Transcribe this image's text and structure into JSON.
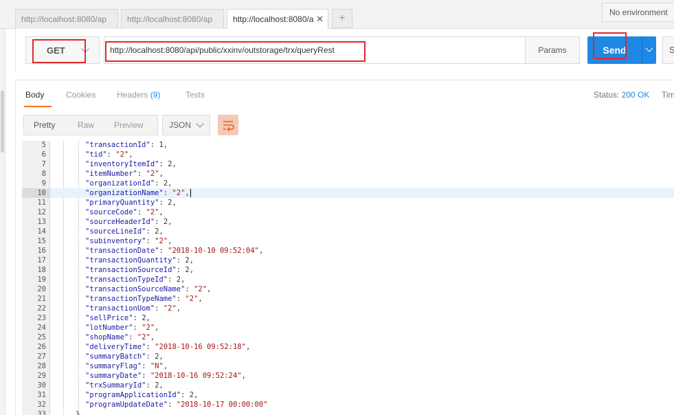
{
  "tabs": [
    {
      "label": "http://localhost:8080/ap",
      "active": false
    },
    {
      "label": "http://localhost:8080/ap",
      "active": false
    },
    {
      "label": "http://localhost:8080/a",
      "active": true
    }
  ],
  "tab_close_glyph": "✕",
  "tab_add_glyph": "+",
  "environment": "No environment",
  "request": {
    "method": "GET",
    "url": "http://localhost:8080/api/public/xxinv/outstorage/trx/queryRest",
    "params_label": "Params",
    "send_label": "Send",
    "save_label": "S"
  },
  "response": {
    "tabs": {
      "body": "Body",
      "cookies": "Cookies",
      "headers": "Headers",
      "headers_count": "(9)",
      "tests": "Tests"
    },
    "status_label": "Status:",
    "status_value": "200 OK",
    "time_label": "Tim",
    "view_modes": [
      "Pretty",
      "Raw",
      "Preview"
    ],
    "format": "JSON",
    "wrap_icon": "wrap-lines-icon"
  },
  "code_lines": [
    {
      "n": "5",
      "key": "\"transactionId\"",
      "val": "1",
      "t": "n"
    },
    {
      "n": "6",
      "key": "\"tid\"",
      "val": "\"2\"",
      "t": "s"
    },
    {
      "n": "7",
      "key": "\"inventoryItemId\"",
      "val": "2",
      "t": "n"
    },
    {
      "n": "8",
      "key": "\"itemNumber\"",
      "val": "\"2\"",
      "t": "s"
    },
    {
      "n": "9",
      "key": "\"organizationId\"",
      "val": "2",
      "t": "n"
    },
    {
      "n": "10",
      "key": "\"organizationName\"",
      "val": "\"2\"",
      "t": "s"
    },
    {
      "n": "11",
      "key": "\"primaryQuantity\"",
      "val": "2",
      "t": "n"
    },
    {
      "n": "12",
      "key": "\"sourceCode\"",
      "val": "\"2\"",
      "t": "s"
    },
    {
      "n": "13",
      "key": "\"sourceHeaderId\"",
      "val": "2",
      "t": "n"
    },
    {
      "n": "14",
      "key": "\"sourceLineId\"",
      "val": "2",
      "t": "n"
    },
    {
      "n": "15",
      "key": "\"subinventory\"",
      "val": "\"2\"",
      "t": "s"
    },
    {
      "n": "16",
      "key": "\"transactionDate\"",
      "val": "\"2018-10-10 09:52:04\"",
      "t": "s"
    },
    {
      "n": "17",
      "key": "\"transactionQuantity\"",
      "val": "2",
      "t": "n"
    },
    {
      "n": "18",
      "key": "\"transactionSourceId\"",
      "val": "2",
      "t": "n"
    },
    {
      "n": "19",
      "key": "\"transactionTypeId\"",
      "val": "2",
      "t": "n"
    },
    {
      "n": "20",
      "key": "\"transactionSourceName\"",
      "val": "\"2\"",
      "t": "s"
    },
    {
      "n": "21",
      "key": "\"transactionTypeName\"",
      "val": "\"2\"",
      "t": "s"
    },
    {
      "n": "22",
      "key": "\"transactionUom\"",
      "val": "\"2\"",
      "t": "s"
    },
    {
      "n": "23",
      "key": "\"sellPrice\"",
      "val": "2",
      "t": "n"
    },
    {
      "n": "24",
      "key": "\"lotNumber\"",
      "val": "\"2\"",
      "t": "s"
    },
    {
      "n": "25",
      "key": "\"shopName\"",
      "val": "\"2\"",
      "t": "s"
    },
    {
      "n": "26",
      "key": "\"deliveryTime\"",
      "val": "\"2018-10-16 09:52:18\"",
      "t": "s"
    },
    {
      "n": "27",
      "key": "\"summaryBatch\"",
      "val": "2",
      "t": "n"
    },
    {
      "n": "28",
      "key": "\"summaryFlag\"",
      "val": "\"N\"",
      "t": "s"
    },
    {
      "n": "29",
      "key": "\"summaryDate\"",
      "val": "\"2018-10-16 09:52:24\"",
      "t": "s"
    },
    {
      "n": "30",
      "key": "\"trxSummaryId\"",
      "val": "2",
      "t": "n"
    },
    {
      "n": "31",
      "key": "\"programApplicationId\"",
      "val": "2",
      "t": "n"
    },
    {
      "n": "32",
      "key": "\"programUpdateDate\"",
      "val": "\"2018-10-17 00:00:00\"",
      "t": "s",
      "last": true
    },
    {
      "n": "33",
      "raw": "}"
    }
  ],
  "current_line": "10",
  "colors": {
    "accent": "#1e88e5",
    "tab_underline": "#f47023",
    "highlight_box": "#e0282d"
  }
}
